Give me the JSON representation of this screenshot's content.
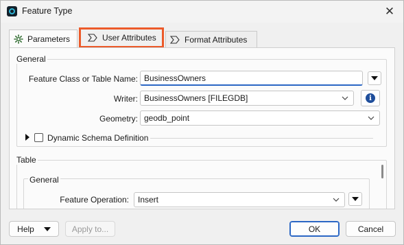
{
  "window": {
    "title": "Feature Type"
  },
  "tabs": [
    {
      "label": "Parameters",
      "icon": "gear-icon"
    },
    {
      "label": "User Attributes",
      "icon": "attribute-icon"
    },
    {
      "label": "Format Attributes",
      "icon": "attribute-icon"
    }
  ],
  "general": {
    "title": "General",
    "feature_class_label": "Feature Class or Table Name:",
    "feature_class_value": "BusinessOwners",
    "writer_label": "Writer:",
    "writer_value": "BusinessOwners [FILEGDB]",
    "geometry_label": "Geometry:",
    "geometry_value": "geodb_point",
    "dynamic_schema_label": "Dynamic Schema Definition",
    "dynamic_schema_checked": false
  },
  "table": {
    "title": "Table",
    "general_title": "General",
    "feature_operation_label": "Feature Operation:",
    "feature_operation_value": "Insert"
  },
  "buttons": {
    "help": "Help",
    "apply": "Apply to...",
    "ok": "OK",
    "cancel": "Cancel"
  },
  "colors": {
    "highlight": "#ec5a2a",
    "accent": "#2a66c4",
    "info": "#1f4e9b"
  }
}
